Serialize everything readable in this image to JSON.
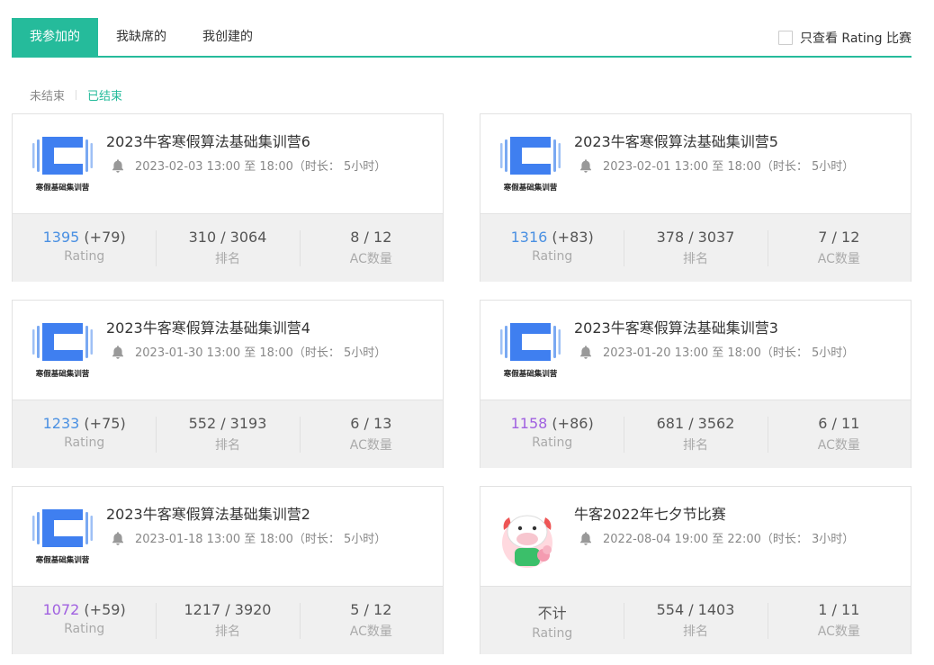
{
  "tabs": [
    {
      "label": "我参加的",
      "active": true
    },
    {
      "label": "我缺席的",
      "active": false
    },
    {
      "label": "我创建的",
      "active": false
    }
  ],
  "rating_filter": {
    "label": "只查看 Rating 比赛",
    "checked": false
  },
  "status_filter": {
    "items": [
      {
        "label": "未结束",
        "active": false
      },
      {
        "label": "已结束",
        "active": true
      }
    ]
  },
  "logo_text": "寒假基础集训营",
  "labels": {
    "rating": "Rating",
    "rank": "排名",
    "ac": "AC数量"
  },
  "colors": {
    "accent": "#25bb9b",
    "rating_blue": "#4a90e2",
    "rating_purple": "#a060e0"
  },
  "contests": [
    {
      "title": "2023牛客寒假算法基础集训营6",
      "time": "2023-02-03 13:00 至 18:00（时长： 5小时）",
      "rating": "1395",
      "rating_delta": " (+79)",
      "rank": "310 / 3064",
      "ac": "8 / 12",
      "logo": "winter-camp-logo",
      "rating_color": "blue"
    },
    {
      "title": "2023牛客寒假算法基础集训营5",
      "time": "2023-02-01 13:00 至 18:00（时长： 5小时）",
      "rating": "1316",
      "rating_delta": " (+83)",
      "rank": "378 / 3037",
      "ac": "7 / 12",
      "logo": "winter-camp-logo",
      "rating_color": "blue"
    },
    {
      "title": "2023牛客寒假算法基础集训营4",
      "time": "2023-01-30 13:00 至 18:00（时长： 5小时）",
      "rating": "1233",
      "rating_delta": " (+75)",
      "rank": "552 / 3193",
      "ac": "6 / 13",
      "logo": "winter-camp-logo",
      "rating_color": "blue"
    },
    {
      "title": "2023牛客寒假算法基础集训营3",
      "time": "2023-01-20 13:00 至 18:00（时长： 5小时）",
      "rating": "1158",
      "rating_delta": " (+86)",
      "rank": "681 / 3562",
      "ac": "6 / 11",
      "logo": "winter-camp-logo",
      "rating_color": "purple"
    },
    {
      "title": "2023牛客寒假算法基础集训营2",
      "time": "2023-01-18 13:00 至 18:00（时长： 5小时）",
      "rating": "1072",
      "rating_delta": " (+59)",
      "rank": "1217 / 3920",
      "ac": "5 / 12",
      "logo": "winter-camp-logo",
      "rating_color": "purple"
    },
    {
      "title": "牛客2022年七夕节比赛",
      "time": "2022-08-04 19:00 至 22:00（时长： 3小时）",
      "rating": "不计",
      "rating_delta": "",
      "rank": "554 / 1403",
      "ac": "1 / 11",
      "logo": "cow-mascot-logo",
      "rating_color": "plain"
    }
  ]
}
